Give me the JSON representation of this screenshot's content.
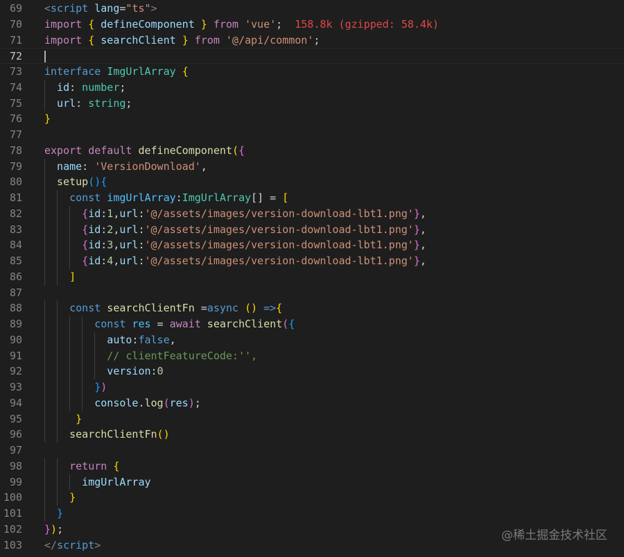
{
  "editor": {
    "language": "ts",
    "current_line": 72,
    "import_cost_hint": "158.8k (gzipped: 58.4k)",
    "lines": [
      {
        "n": 69,
        "indent": 0,
        "tokens": [
          [
            "tag",
            "<"
          ],
          [
            "tagname",
            "script"
          ],
          [
            "plain",
            " "
          ],
          [
            "attr",
            "lang"
          ],
          [
            "plain",
            "="
          ],
          [
            "str",
            "\"ts\""
          ],
          [
            "tag",
            ">"
          ]
        ]
      },
      {
        "n": 70,
        "indent": 0,
        "tokens": [
          [
            "kw",
            "import"
          ],
          [
            "plain",
            " "
          ],
          [
            "b1",
            "{"
          ],
          [
            "plain",
            " "
          ],
          [
            "var",
            "defineComponent"
          ],
          [
            "plain",
            " "
          ],
          [
            "b1",
            "}"
          ],
          [
            "plain",
            " "
          ],
          [
            "kw",
            "from"
          ],
          [
            "plain",
            " "
          ],
          [
            "str",
            "'vue'"
          ],
          [
            "plain",
            ";  "
          ],
          [
            "hint",
            "158.8k (gzipped: 58.4k)"
          ]
        ]
      },
      {
        "n": 71,
        "indent": 0,
        "tokens": [
          [
            "kw",
            "import"
          ],
          [
            "plain",
            " "
          ],
          [
            "b1",
            "{"
          ],
          [
            "plain",
            " "
          ],
          [
            "var",
            "searchClient"
          ],
          [
            "plain",
            " "
          ],
          [
            "b1",
            "}"
          ],
          [
            "plain",
            " "
          ],
          [
            "kw",
            "from"
          ],
          [
            "plain",
            " "
          ],
          [
            "str",
            "'@/api/common'"
          ],
          [
            "plain",
            ";"
          ]
        ]
      },
      {
        "n": 72,
        "indent": 0,
        "tokens": []
      },
      {
        "n": 73,
        "indent": 0,
        "tokens": [
          [
            "blue",
            "interface"
          ],
          [
            "plain",
            " "
          ],
          [
            "type",
            "ImgUrlArray"
          ],
          [
            "plain",
            " "
          ],
          [
            "b1",
            "{"
          ]
        ]
      },
      {
        "n": 74,
        "indent": 1,
        "tokens": [
          [
            "var",
            "id"
          ],
          [
            "plain",
            ": "
          ],
          [
            "type",
            "number"
          ],
          [
            "plain",
            ";"
          ]
        ]
      },
      {
        "n": 75,
        "indent": 1,
        "tokens": [
          [
            "var",
            "url"
          ],
          [
            "plain",
            ": "
          ],
          [
            "type",
            "string"
          ],
          [
            "plain",
            ";"
          ]
        ]
      },
      {
        "n": 76,
        "indent": 0,
        "tokens": [
          [
            "b1",
            "}"
          ]
        ]
      },
      {
        "n": 77,
        "indent": 0,
        "tokens": []
      },
      {
        "n": 78,
        "indent": 0,
        "tokens": [
          [
            "kw",
            "export"
          ],
          [
            "plain",
            " "
          ],
          [
            "kw",
            "default"
          ],
          [
            "plain",
            " "
          ],
          [
            "fn",
            "defineComponent"
          ],
          [
            "b1",
            "("
          ],
          [
            "b2",
            "{"
          ]
        ]
      },
      {
        "n": 79,
        "indent": 1,
        "tokens": [
          [
            "var",
            "name"
          ],
          [
            "plain",
            ": "
          ],
          [
            "str",
            "'VersionDownload'"
          ],
          [
            "plain",
            ","
          ]
        ]
      },
      {
        "n": 80,
        "indent": 1,
        "tokens": [
          [
            "fn",
            "setup"
          ],
          [
            "b3",
            "()"
          ],
          [
            "b3",
            "{"
          ]
        ]
      },
      {
        "n": 81,
        "indent": 2,
        "tokens": [
          [
            "blue",
            "const"
          ],
          [
            "plain",
            " "
          ],
          [
            "const",
            "imgUrlArray"
          ],
          [
            "plain",
            ":"
          ],
          [
            "type",
            "ImgUrlArray"
          ],
          [
            "plain",
            "[] = "
          ],
          [
            "b1",
            "["
          ]
        ]
      },
      {
        "n": 82,
        "indent": 3,
        "tokens": [
          [
            "b2",
            "{"
          ],
          [
            "var",
            "id"
          ],
          [
            "plain",
            ":"
          ],
          [
            "num",
            "1"
          ],
          [
            "plain",
            ","
          ],
          [
            "var",
            "url"
          ],
          [
            "plain",
            ":"
          ],
          [
            "str",
            "'@/assets/images/version-download-lbt1.png'"
          ],
          [
            "b2",
            "}"
          ],
          [
            "plain",
            ","
          ]
        ]
      },
      {
        "n": 83,
        "indent": 3,
        "tokens": [
          [
            "b2",
            "{"
          ],
          [
            "var",
            "id"
          ],
          [
            "plain",
            ":"
          ],
          [
            "num",
            "2"
          ],
          [
            "plain",
            ","
          ],
          [
            "var",
            "url"
          ],
          [
            "plain",
            ":"
          ],
          [
            "str",
            "'@/assets/images/version-download-lbt1.png'"
          ],
          [
            "b2",
            "}"
          ],
          [
            "plain",
            ","
          ]
        ]
      },
      {
        "n": 84,
        "indent": 3,
        "tokens": [
          [
            "b2",
            "{"
          ],
          [
            "var",
            "id"
          ],
          [
            "plain",
            ":"
          ],
          [
            "num",
            "3"
          ],
          [
            "plain",
            ","
          ],
          [
            "var",
            "url"
          ],
          [
            "plain",
            ":"
          ],
          [
            "str",
            "'@/assets/images/version-download-lbt1.png'"
          ],
          [
            "b2",
            "}"
          ],
          [
            "plain",
            ","
          ]
        ]
      },
      {
        "n": 85,
        "indent": 3,
        "tokens": [
          [
            "b2",
            "{"
          ],
          [
            "var",
            "id"
          ],
          [
            "plain",
            ":"
          ],
          [
            "num",
            "4"
          ],
          [
            "plain",
            ","
          ],
          [
            "var",
            "url"
          ],
          [
            "plain",
            ":"
          ],
          [
            "str",
            "'@/assets/images/version-download-lbt1.png'"
          ],
          [
            "b2",
            "}"
          ],
          [
            "plain",
            ","
          ]
        ]
      },
      {
        "n": 86,
        "indent": 2,
        "tokens": [
          [
            "b1",
            "]"
          ]
        ]
      },
      {
        "n": 87,
        "indent": 0,
        "tokens": []
      },
      {
        "n": 88,
        "indent": 2,
        "tokens": [
          [
            "blue",
            "const"
          ],
          [
            "plain",
            " "
          ],
          [
            "fn",
            "searchClientFn"
          ],
          [
            "plain",
            " ="
          ],
          [
            "blue",
            "async"
          ],
          [
            "plain",
            " "
          ],
          [
            "b1",
            "()"
          ],
          [
            "plain",
            " "
          ],
          [
            "blue",
            "=>"
          ],
          [
            "b1",
            "{"
          ]
        ]
      },
      {
        "n": 89,
        "indent": 4,
        "tokens": [
          [
            "blue",
            "const"
          ],
          [
            "plain",
            " "
          ],
          [
            "const",
            "res"
          ],
          [
            "plain",
            " = "
          ],
          [
            "kw",
            "await"
          ],
          [
            "plain",
            " "
          ],
          [
            "fn",
            "searchClient"
          ],
          [
            "b2",
            "("
          ],
          [
            "b3",
            "{"
          ]
        ]
      },
      {
        "n": 90,
        "indent": 5,
        "tokens": [
          [
            "var",
            "auto"
          ],
          [
            "plain",
            ":"
          ],
          [
            "blue",
            "false"
          ],
          [
            "plain",
            ","
          ]
        ]
      },
      {
        "n": 91,
        "indent": 5,
        "tokens": [
          [
            "com",
            "// clientFeatureCode:'',"
          ]
        ]
      },
      {
        "n": 92,
        "indent": 5,
        "tokens": [
          [
            "var",
            "version"
          ],
          [
            "plain",
            ":"
          ],
          [
            "num",
            "0"
          ]
        ]
      },
      {
        "n": 93,
        "indent": 4,
        "tokens": [
          [
            "b3",
            "}"
          ],
          [
            "b2",
            ")"
          ]
        ]
      },
      {
        "n": 94,
        "indent": 4,
        "tokens": [
          [
            "var",
            "console"
          ],
          [
            "plain",
            "."
          ],
          [
            "fn",
            "log"
          ],
          [
            "b2",
            "("
          ],
          [
            "var",
            "res"
          ],
          [
            "b2",
            ")"
          ],
          [
            "plain",
            ";"
          ]
        ]
      },
      {
        "n": 95,
        "indent": 2,
        "pad": " ",
        "tokens": [
          [
            "b1",
            "}"
          ]
        ]
      },
      {
        "n": 96,
        "indent": 2,
        "tokens": [
          [
            "fn",
            "searchClientFn"
          ],
          [
            "b1",
            "()"
          ]
        ]
      },
      {
        "n": 97,
        "indent": 0,
        "tokens": []
      },
      {
        "n": 98,
        "indent": 2,
        "tokens": [
          [
            "kw",
            "return"
          ],
          [
            "plain",
            " "
          ],
          [
            "b1",
            "{"
          ]
        ]
      },
      {
        "n": 99,
        "indent": 3,
        "tokens": [
          [
            "var",
            "imgUrlArray"
          ]
        ]
      },
      {
        "n": 100,
        "indent": 2,
        "tokens": [
          [
            "b1",
            "}"
          ]
        ]
      },
      {
        "n": 101,
        "indent": 1,
        "tokens": [
          [
            "b3",
            "}"
          ]
        ]
      },
      {
        "n": 102,
        "indent": 0,
        "tokens": [
          [
            "b2",
            "}"
          ],
          [
            "b1",
            ")"
          ],
          [
            "plain",
            ";"
          ]
        ]
      },
      {
        "n": 103,
        "indent": 0,
        "tokens": [
          [
            "tag",
            "</"
          ],
          [
            "tagname",
            "script"
          ],
          [
            "tag",
            ">"
          ]
        ]
      }
    ]
  },
  "watermark": "@稀土掘金技术社区"
}
